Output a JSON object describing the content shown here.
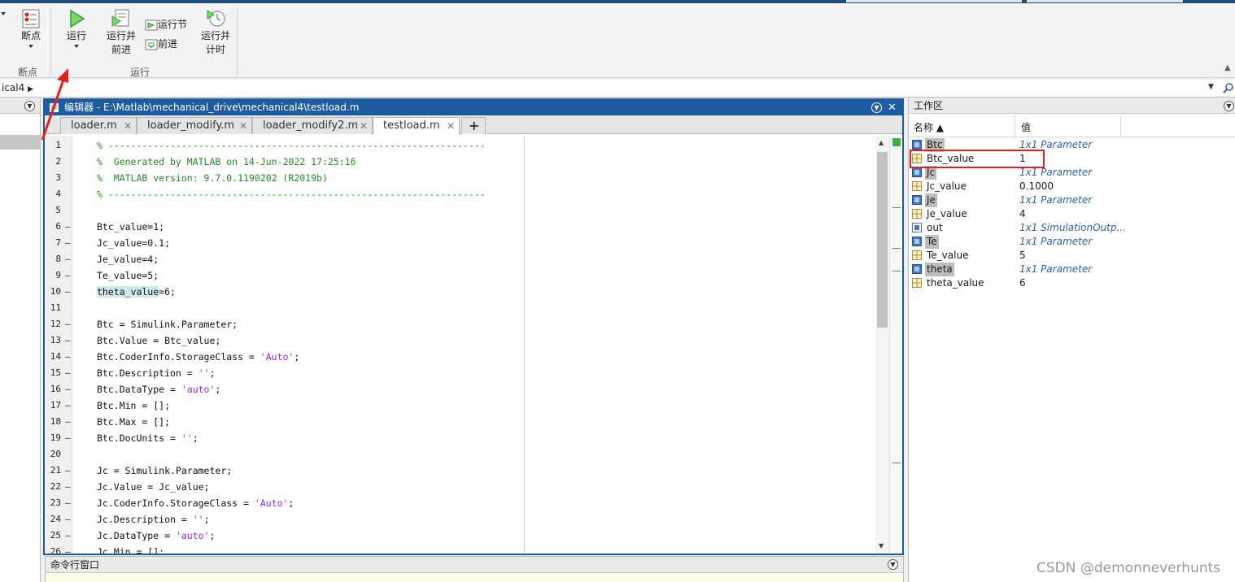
{
  "ribbon": {
    "breakpoints_label": "断点",
    "breakpoints_group": "断点",
    "run_label": "运行",
    "run_advance_line1": "运行并",
    "run_advance_line2": "前进",
    "run_section_label": "运行节",
    "advance_label": "前进",
    "run_time_line1": "运行并",
    "run_time_line2": "计时",
    "run_group": "运行"
  },
  "address": {
    "crumb": "ical4"
  },
  "editor": {
    "title": "编辑器 - E:\\Matlab\\mechanical_drive\\mechanical4\\testload.m",
    "tabs": [
      {
        "label": "loader.m"
      },
      {
        "label": "loader_modify.m"
      },
      {
        "label": "loader_modify2.m"
      },
      {
        "label": "testload.m"
      }
    ],
    "new_tab": "+",
    "lines": [
      {
        "n": "1",
        "t": "% -------------------------------------------------------------------"
      },
      {
        "n": "2",
        "t": "%  Generated by MATLAB on 14-Jun-2022 17:25:16"
      },
      {
        "n": "3",
        "t": "%  MATLAB version: 9.7.0.1190202 (R2019b)"
      },
      {
        "n": "4",
        "t": "% -------------------------------------------------------------------"
      },
      {
        "n": "5",
        "t": ""
      },
      {
        "n": "6",
        "t": "Btc_value=1;"
      },
      {
        "n": "7",
        "t": "Jc_value=0.1;"
      },
      {
        "n": "8",
        "t": "Je_value=4;"
      },
      {
        "n": "9",
        "t": "Te_value=5;"
      },
      {
        "n": "10",
        "t": "theta_value=6;"
      },
      {
        "n": "11",
        "t": ""
      },
      {
        "n": "12",
        "t": "Btc = Simulink.Parameter;"
      },
      {
        "n": "13",
        "t": "Btc.Value = Btc_value;"
      },
      {
        "n": "14",
        "t": "Btc.CoderInfo.StorageClass = 'Auto';"
      },
      {
        "n": "15",
        "t": "Btc.Description = '';"
      },
      {
        "n": "16",
        "t": "Btc.DataType = 'auto';"
      },
      {
        "n": "17",
        "t": "Btc.Min = [];"
      },
      {
        "n": "18",
        "t": "Btc.Max = [];"
      },
      {
        "n": "19",
        "t": "Btc.DocUnits = '';"
      },
      {
        "n": "20",
        "t": ""
      },
      {
        "n": "21",
        "t": "Jc = Simulink.Parameter;"
      },
      {
        "n": "22",
        "t": "Jc.Value = Jc_value;"
      },
      {
        "n": "23",
        "t": "Jc.CoderInfo.StorageClass = 'Auto';"
      },
      {
        "n": "24",
        "t": "Jc.Description = '';"
      },
      {
        "n": "25",
        "t": "Jc.DataType = 'auto';"
      },
      {
        "n": "26",
        "t": "Jc.Min = [];"
      }
    ]
  },
  "command_window": {
    "title": "命令行窗口"
  },
  "workspace": {
    "title": "工作区",
    "col_name": "名称 ▲",
    "col_value": "值",
    "rows": [
      {
        "name": "Btc",
        "value": "1x1 Parameter",
        "kind": "param"
      },
      {
        "name": "Btc_value",
        "value": "1",
        "kind": "double"
      },
      {
        "name": "Jc",
        "value": "1x1 Parameter",
        "kind": "param"
      },
      {
        "name": "Jc_value",
        "value": "0.1000",
        "kind": "double"
      },
      {
        "name": "Je",
        "value": "1x1 Parameter",
        "kind": "param"
      },
      {
        "name": "Je_value",
        "value": "4",
        "kind": "double"
      },
      {
        "name": "out",
        "value": "1x1 SimulationOutp...",
        "kind": "sim"
      },
      {
        "name": "Te",
        "value": "1x1 Parameter",
        "kind": "param"
      },
      {
        "name": "Te_value",
        "value": "5",
        "kind": "double"
      },
      {
        "name": "theta",
        "value": "1x1 Parameter",
        "kind": "param"
      },
      {
        "name": "theta_value",
        "value": "6",
        "kind": "double"
      }
    ]
  },
  "watermark": "CSDN @demonneverhunts",
  "colors": {
    "accent": "#1d5ca0",
    "highlight_box": "#e0221c",
    "run_green": "#2fa52f"
  }
}
